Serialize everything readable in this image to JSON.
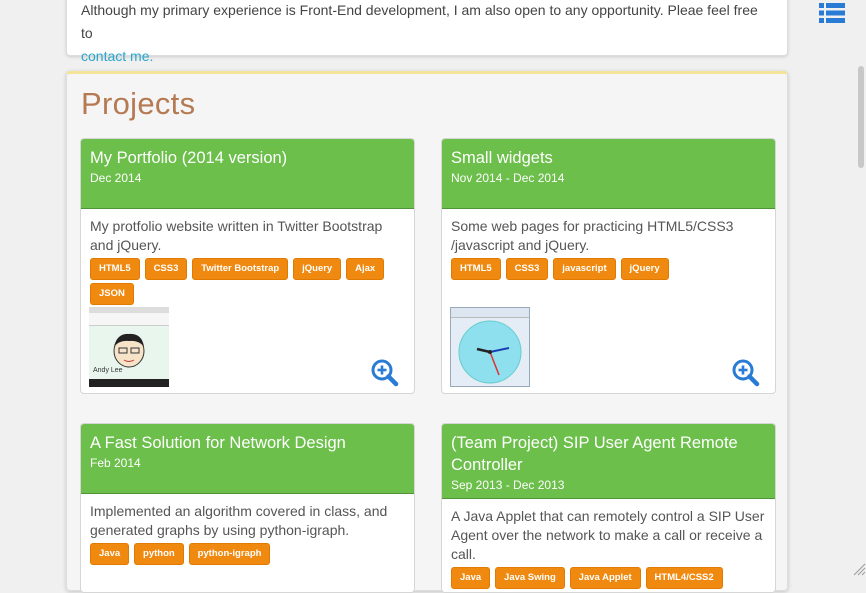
{
  "about": {
    "text": "Although my primary experience is Front-End development, I am also open to any opportunity. Pleae feel free to",
    "contact_link": "contact me."
  },
  "projects": {
    "heading": "Projects",
    "items": [
      {
        "title": "My Portfolio (2014 version)",
        "date": "Dec 2014",
        "description": "My protfolio website written in Twitter Bootstrap and jQuery.",
        "tags": [
          "HTML5",
          "CSS3",
          "Twitter Bootstrap",
          "jQuery",
          "Ajax",
          "JSON"
        ],
        "thumbnail": {
          "icon": "portfolio-screenshot",
          "caption": "Andy Lee"
        }
      },
      {
        "title": "Small widgets",
        "date": "Nov 2014 - Dec 2014",
        "description": "Some web pages for practicing HTML5/CSS3 /javascript and jQuery.",
        "tags": [
          "HTML5",
          "CSS3",
          "javascript",
          "jQuery"
        ],
        "thumbnail": {
          "icon": "clock-widget-screenshot"
        }
      },
      {
        "title": "A Fast Solution for Network Design",
        "date": "Feb 2014",
        "description": "Implemented an algorithm covered in class, and generated graphs by using python-igraph.",
        "tags": [
          "Java",
          "python",
          "python-igraph"
        ]
      },
      {
        "title": "(Team Project) SIP User Agent Remote Controller",
        "date": "Sep 2013 - Dec 2013",
        "description": "A Java Applet that can remotely control a SIP User Agent over the network to make a call or receive a call.",
        "tags": [
          "Java",
          "Java Swing",
          "Java Applet",
          "HTML4/CSS2"
        ]
      }
    ]
  },
  "colors": {
    "card_header": "#6bbf4a",
    "tag": "#f0890f",
    "heading": "#b57a52",
    "link": "#2ba6cb",
    "nav_icon": "#2a7bd6"
  },
  "icons": {
    "nav": "list-icon",
    "enlarge": "zoom-in-icon"
  }
}
